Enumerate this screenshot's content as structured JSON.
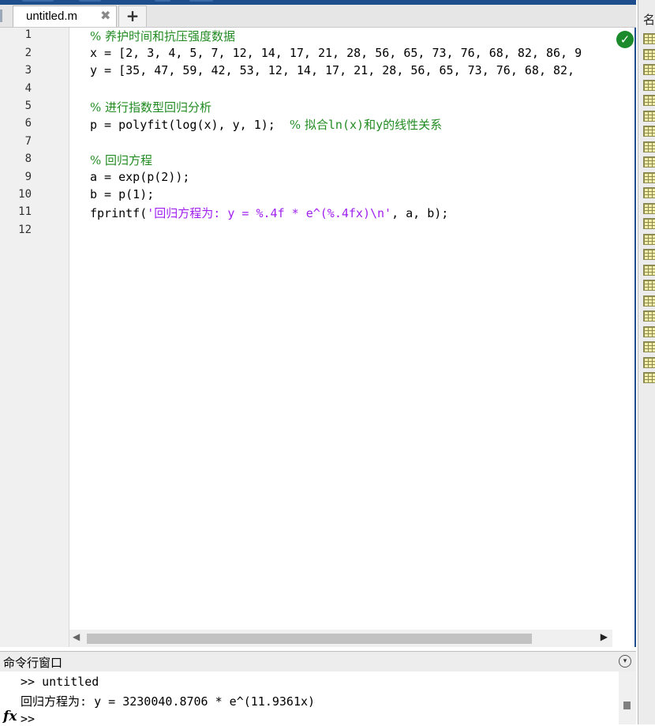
{
  "editor": {
    "tab_label": "untitled.m",
    "close_glyph": "✖",
    "new_tab_glyph": "+",
    "status_icon": "check-circle-icon",
    "line_numbers": [
      "1",
      "2",
      "3",
      "4",
      "5",
      "6",
      "7",
      "8",
      "9",
      "10",
      "11",
      "12"
    ],
    "code": {
      "l1_comment": "% 养护时间和抗压强度数据",
      "l2": "x = [2, 3, 4, 5, 7, 12, 14, 17, 21, 28, 56, 65, 73, 76, 68, 82, 86, 9",
      "l3": "y = [35, 47, 59, 42, 53, 12, 14, 17, 21, 28, 56, 65, 73, 76, 68, 82,",
      "l5_comment": "% 进行指数型回归分析",
      "l6_code": "p = polyfit(log(x), y, 1);  ",
      "l6_comment_a": "% 拟合",
      "l6_comment_b": "ln(x)",
      "l6_comment_c": "和",
      "l6_comment_d": "y",
      "l6_comment_e": "的线性关系",
      "l8_comment": "% 回归方程",
      "l9": "a = exp(p(2));",
      "l10": "b = p(1);",
      "l11_pre": "fprintf(",
      "l11_str_a": "'",
      "l11_str_b": "回归方程为",
      "l11_str_c": ": y = %.4f * e^(%.4fx)\\n'",
      "l11_post": ", a, b);"
    },
    "scroll_left_glyph": "◀",
    "scroll_right_glyph": "▶"
  },
  "right_panel": {
    "header": "名"
  },
  "command_window": {
    "title": "命令行窗口",
    "menu_glyph": "▾",
    "line1": ">> untitled",
    "line2_label": "回归方程为",
    "line2_value": ": y = 3230040.8706 * e^(11.9361x)",
    "fx_label": "fx",
    "prompt": ">>"
  },
  "colors": {
    "accent_blue": "#1f4e8c",
    "comment_green": "#228b22",
    "string_purple": "#a020f0",
    "status_green": "#1a8a2a"
  }
}
